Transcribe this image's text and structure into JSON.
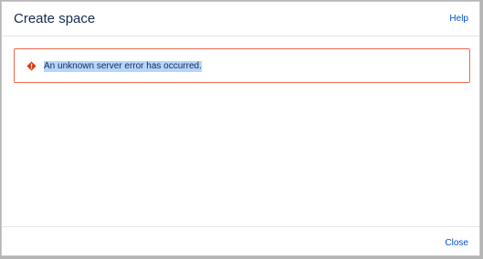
{
  "dialog": {
    "title": "Create space",
    "help_label": "Help",
    "close_label": "Close"
  },
  "error": {
    "icon": "error-icon",
    "message": "An unknown server error has occurred."
  },
  "colors": {
    "title": "#172b4d",
    "link": "#0052cc",
    "error_border": "#e8694f",
    "error_icon": "#de350b",
    "selection": "#b4d5fe"
  }
}
